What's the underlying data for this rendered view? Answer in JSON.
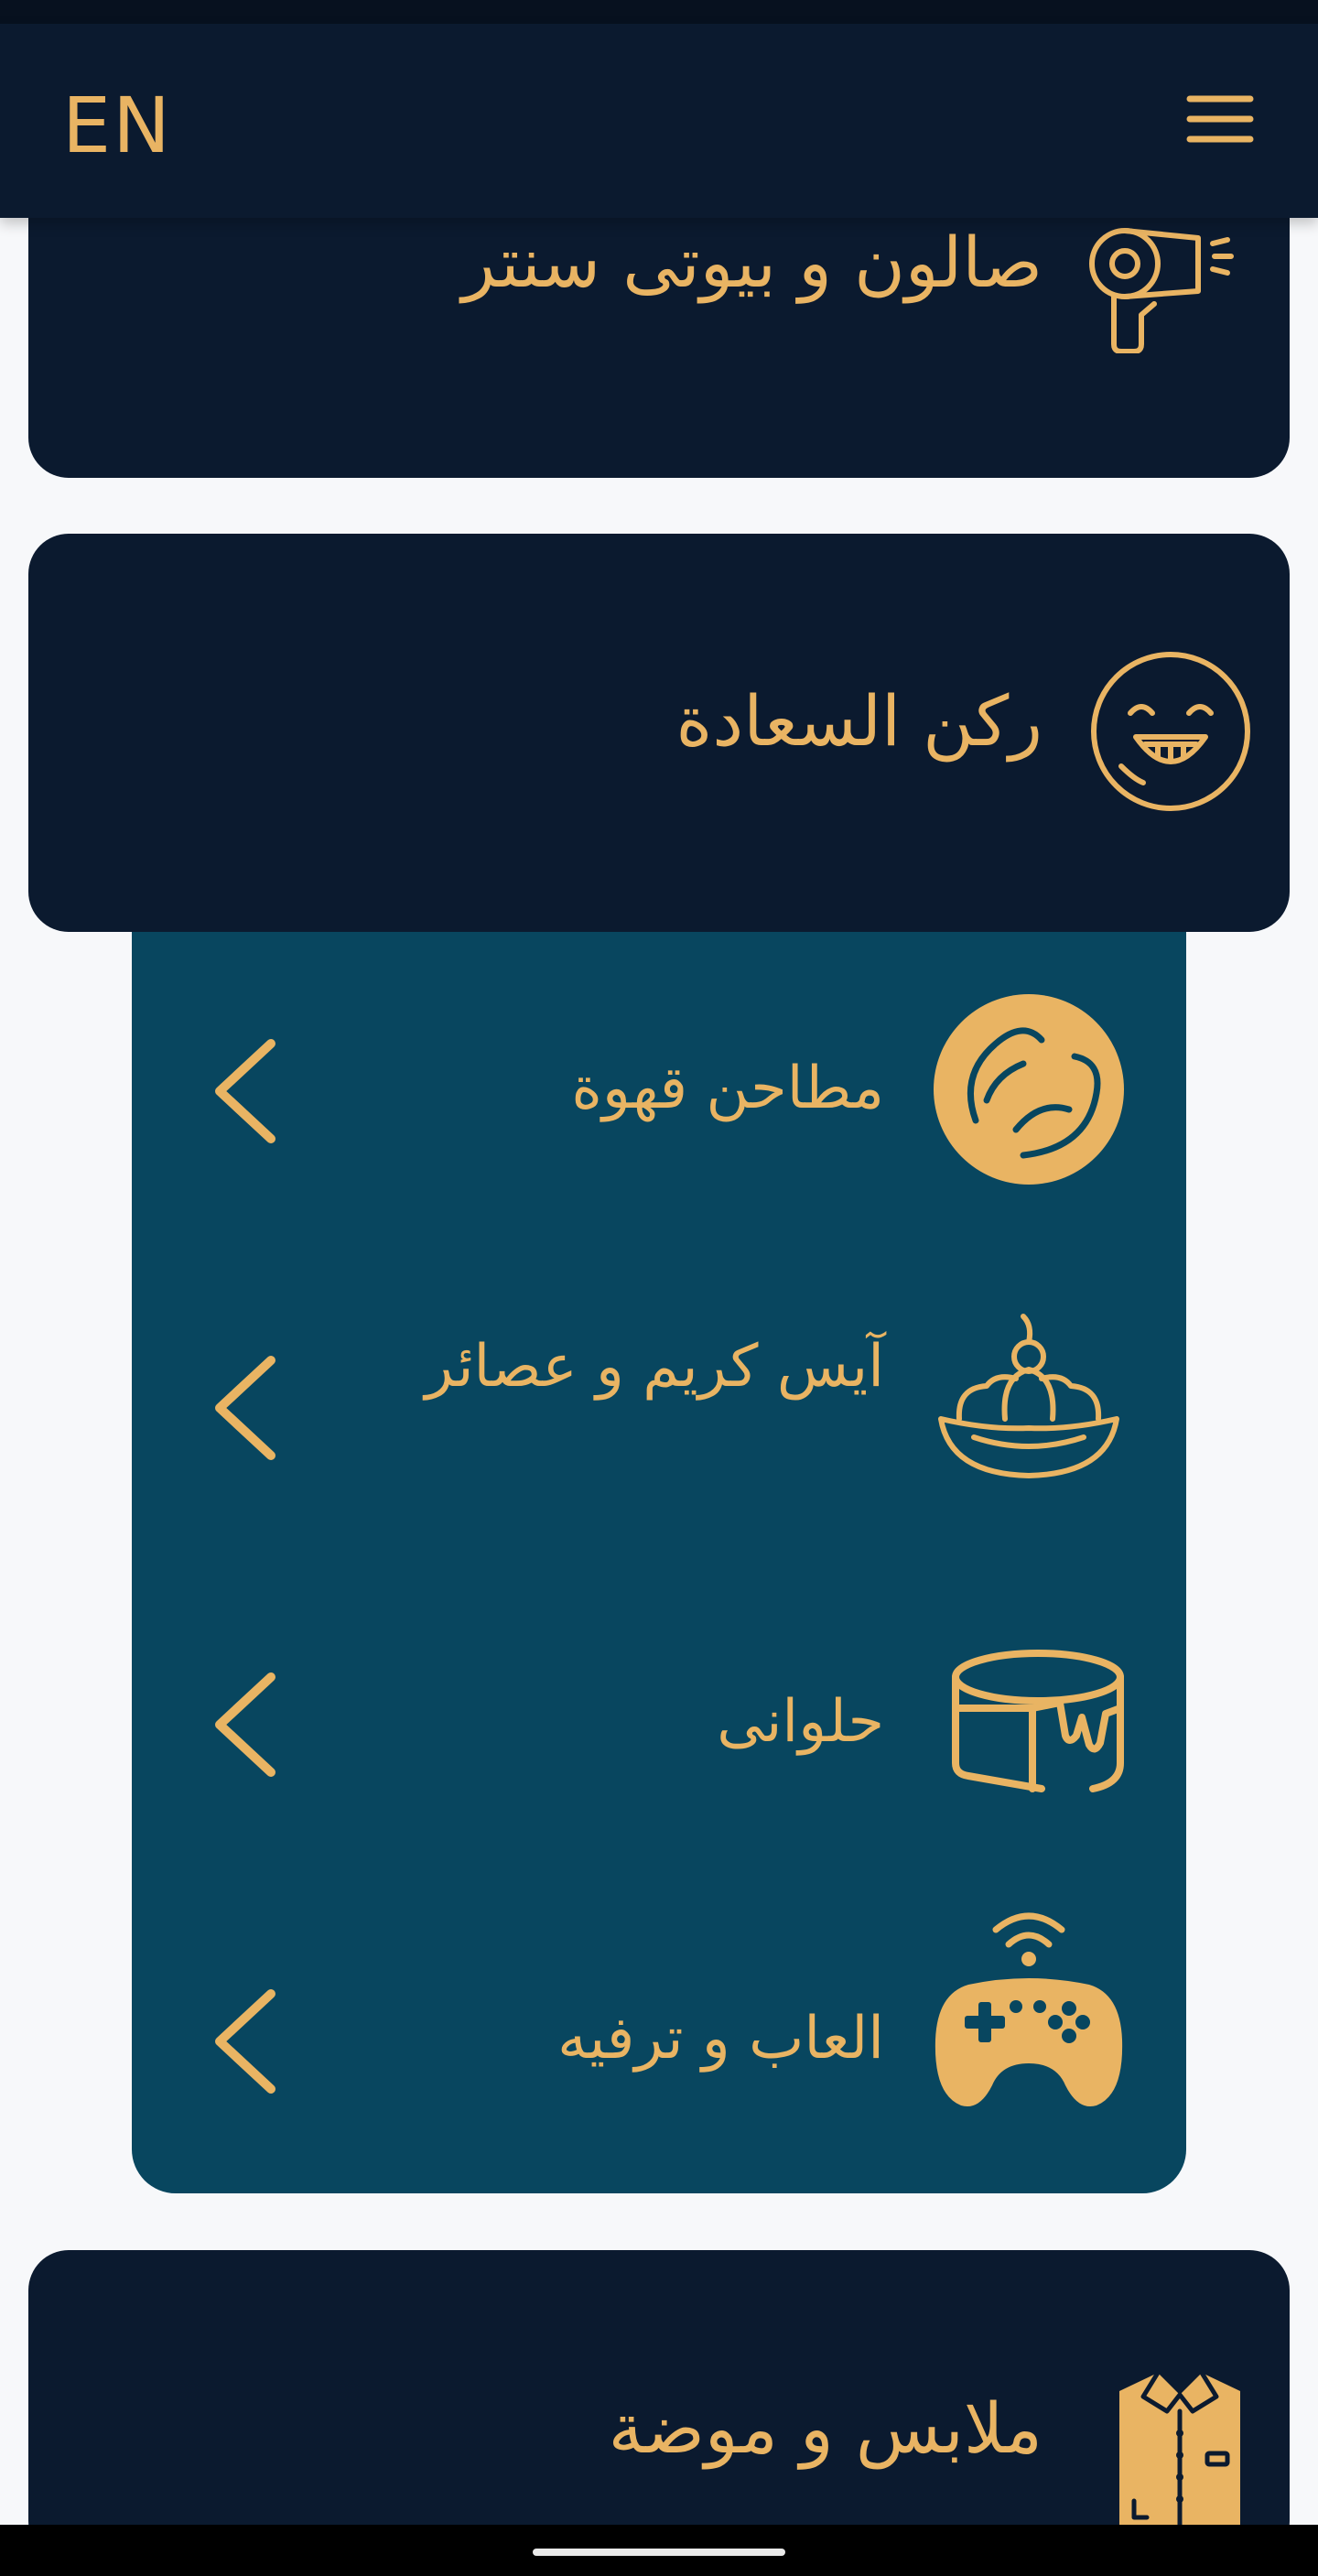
{
  "header": {
    "language_toggle": "EN",
    "menu_icon": "hamburger-menu-icon"
  },
  "categories": [
    {
      "title": "صالون و بيوتى سنتر",
      "icon": "hair-dryer-icon"
    },
    {
      "title": "ركن السعادة",
      "icon": "happy-face-icon",
      "expanded": true
    },
    {
      "title": "ملابس و موضة",
      "icon": "shirt-icon"
    }
  ],
  "subcategories": [
    {
      "label": "مطاحن قهوة",
      "icon": "coffee-beans-icon"
    },
    {
      "label": "آيس كريم و عصائر",
      "icon": "ice-cream-sundae-icon"
    },
    {
      "label": "حلوانى",
      "icon": "cake-icon"
    },
    {
      "label": "العاب و ترفيه",
      "icon": "game-controller-icon"
    }
  ],
  "colors": {
    "navy": "#0b1a2f",
    "panel": "#08465f",
    "gold": "#e9b463",
    "background": "#f7f8fa"
  }
}
